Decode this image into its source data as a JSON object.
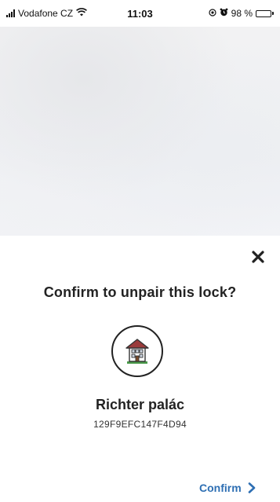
{
  "status_bar": {
    "carrier": "Vodafone CZ",
    "time": "11:03",
    "battery": "98 %",
    "icons": [
      "signal-icon",
      "wifi-icon",
      "location-icon",
      "alarm-icon",
      "battery-icon"
    ]
  },
  "modal": {
    "title": "Confirm to unpair this lock?",
    "close_icon": "close-icon",
    "lock": {
      "icon": "building-icon",
      "name": "Richter palác",
      "id": "129F9EFC147F4D94"
    },
    "confirm_label": "Confirm",
    "confirm_icon": "chevron-right-icon"
  },
  "colors": {
    "accent": "#2e6fb3",
    "text": "#222222",
    "building_roof": "#9a3b3b",
    "building_grass": "#4a9a4a"
  }
}
